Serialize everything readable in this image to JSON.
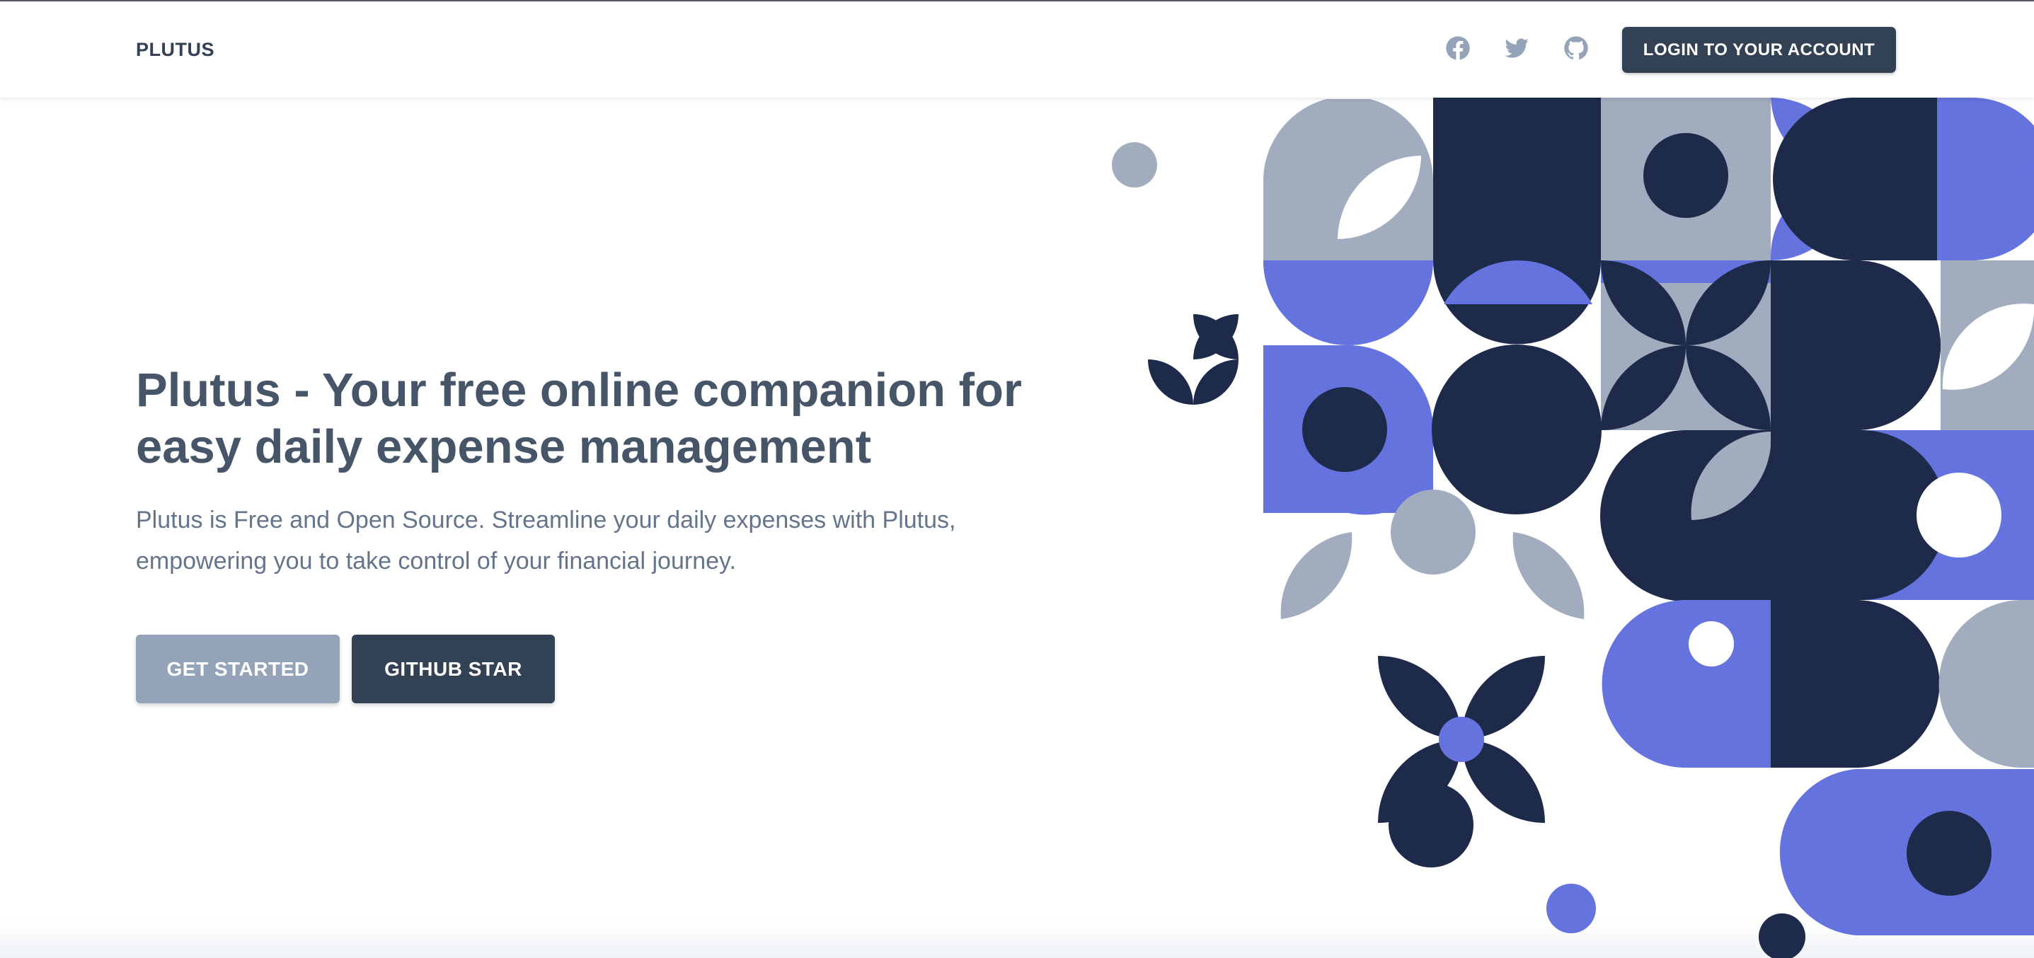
{
  "header": {
    "brand": "PLUTUS",
    "social": [
      {
        "icon": "facebook-icon"
      },
      {
        "icon": "twitter-icon"
      },
      {
        "icon": "github-icon"
      }
    ],
    "login_label": "LOGIN TO YOUR ACCOUNT"
  },
  "hero": {
    "title": "Plutus - Your free online companion for easy daily expense management",
    "description": "Plutus is Free and Open Source. Streamline your daily expenses with Plutus, empowering you to take control of your financial journey.",
    "primary_cta": "GET STARTED",
    "secondary_cta": "GITHUB STAR"
  },
  "theme": {
    "navy": "#1e2a4a",
    "indigo": "#6573df",
    "slate": "#a1adbf",
    "button_dark": "#334155",
    "button_light": "#94a3b8"
  }
}
